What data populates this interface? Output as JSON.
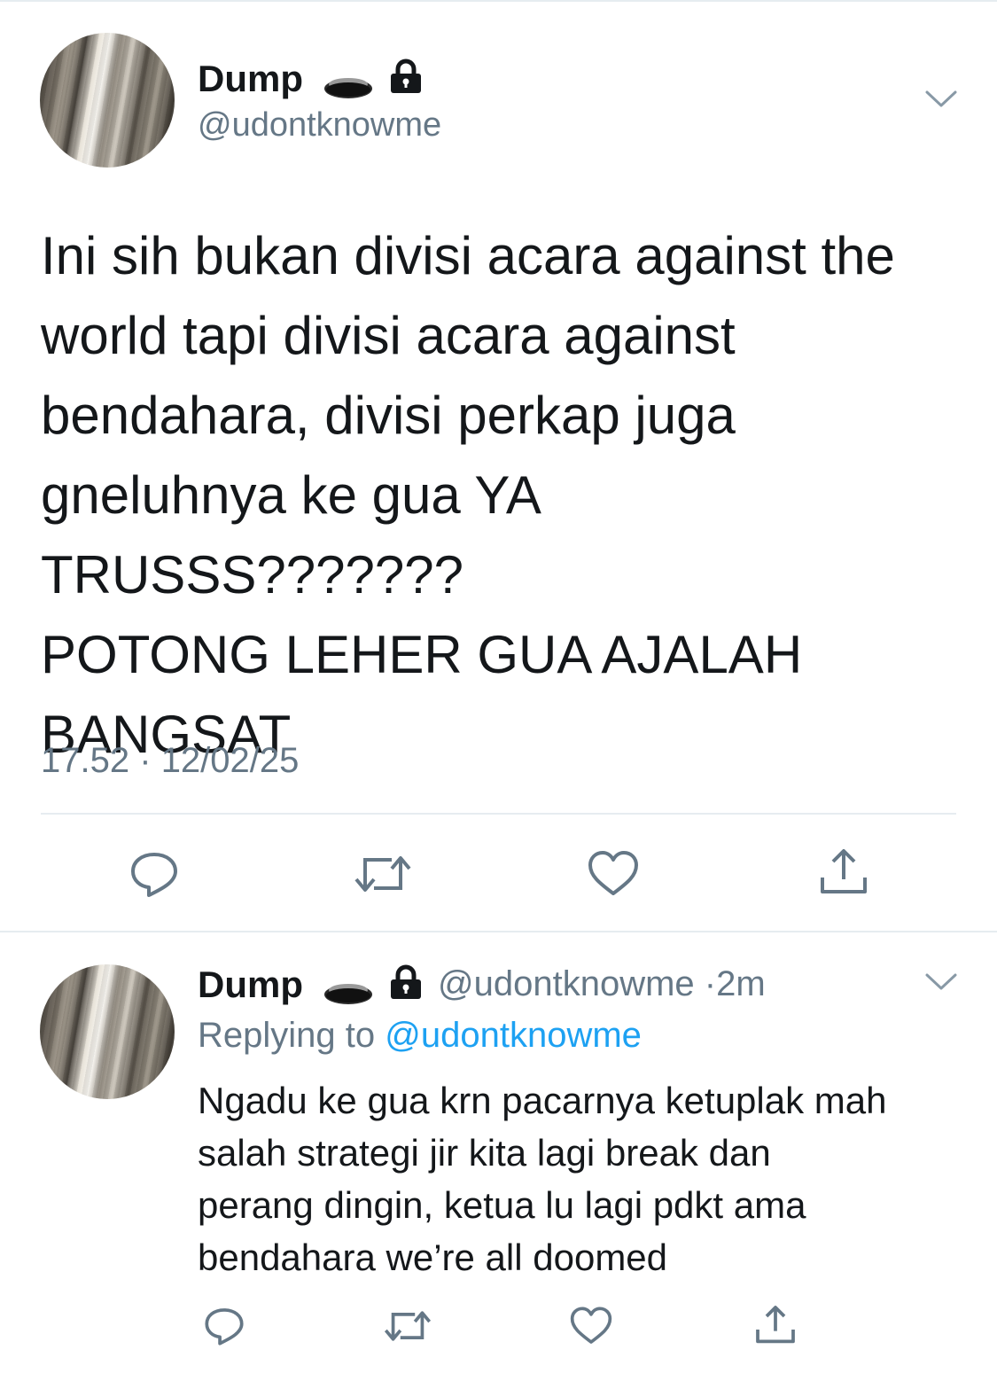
{
  "main_tweet": {
    "author_name": "Dump",
    "author_handle": "@udontknowme",
    "text": "Ini sih bukan divisi acara against the\nworld tapi divisi acara against\nbendahara, divisi perkap juga\ngneluhnya ke gua YA TRUSSS???????\nPOTONG LEHER GUA AJALAH\nBANGSAT",
    "time": "17.52",
    "separator": "·",
    "date": "12/02/25",
    "icons": [
      "hole-emoji-icon",
      "lock-icon",
      "chevron-down-icon",
      "reply-icon",
      "retweet-icon",
      "like-icon",
      "share-icon"
    ]
  },
  "reply_tweet": {
    "author_name": "Dump",
    "author_handle": "@udontknowme",
    "separator": "·",
    "age": "2m",
    "replying_to_label": "Replying to",
    "replying_to_handle": "@udontknowme",
    "text": "Ngadu ke gua krn pacarnya ketuplak mah\nsalah strategi jir kita lagi break dan\nperang dingin, ketua lu lagi pdkt ama\nbendahara we’re all doomed"
  },
  "colors": {
    "text_primary": "#14171a",
    "text_secondary": "#657786",
    "link": "#1da1f2",
    "divider": "#e6ecf0",
    "icon": "#657786"
  }
}
